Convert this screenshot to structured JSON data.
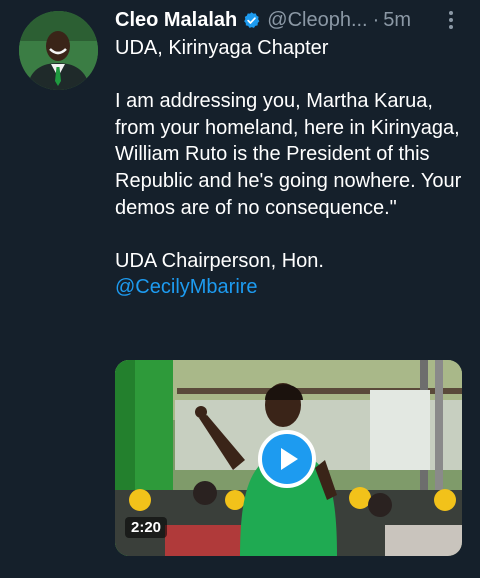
{
  "tweet": {
    "author_name": "Cleo Malalah",
    "author_handle": "@Cleoph...",
    "separator": "·",
    "time": "5m",
    "lines": [
      "UDA, Kirinyaga Chapter",
      "I am addressing you, Martha Karua, from your homeland, here in Kirinyaga, William Ruto is the President of this Republic and he's going nowhere. Your demos are of no consequence.\"",
      "UDA Chairperson, Hon."
    ],
    "mention": "@CecilyMbarire"
  },
  "video": {
    "duration": "2:20"
  },
  "icons": {
    "verified": "verified-badge-icon",
    "more": "more-options-icon",
    "play": "play-icon"
  },
  "colors": {
    "background": "#15202b",
    "accent": "#1d9bf0",
    "secondary_text": "#8b98a5"
  }
}
